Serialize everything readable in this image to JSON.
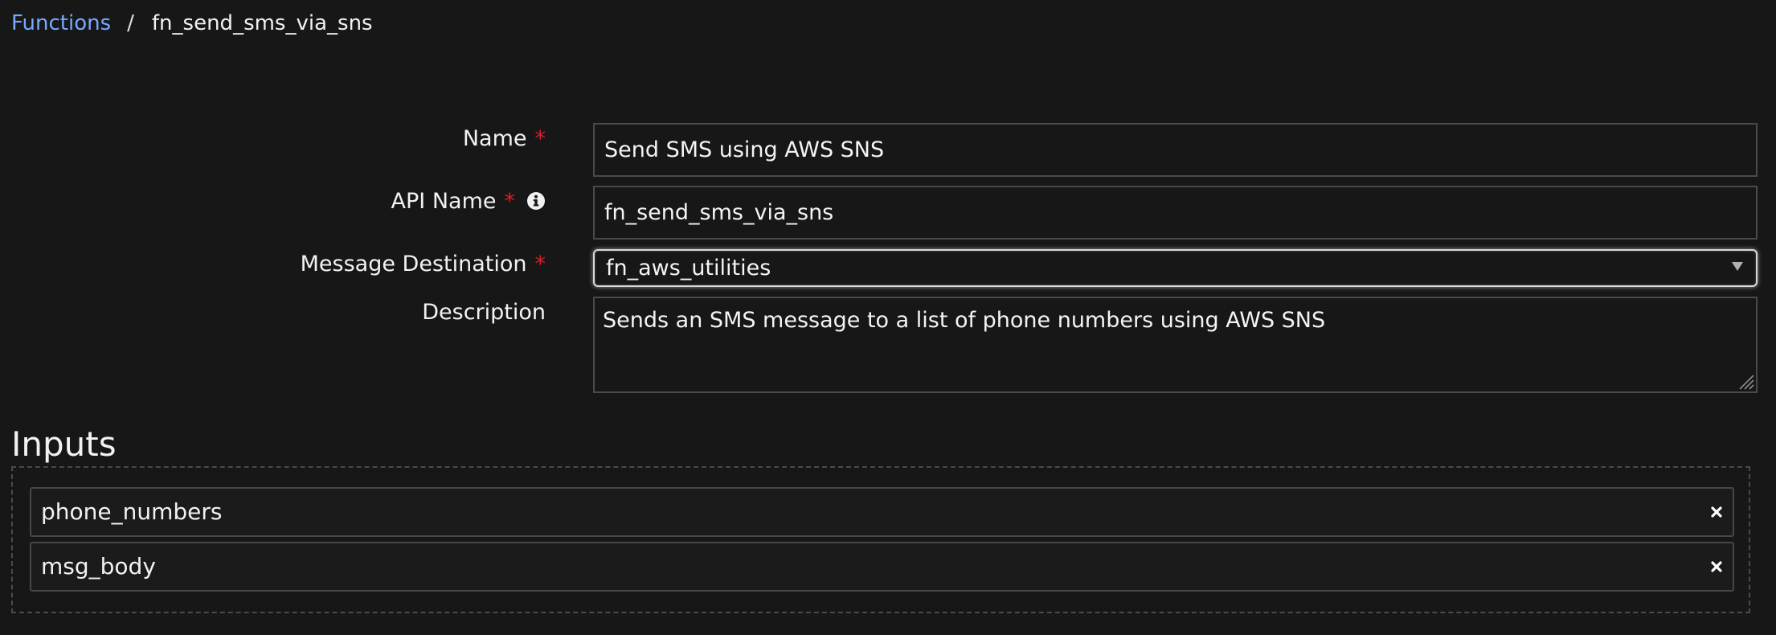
{
  "breadcrumb": {
    "parent": "Functions",
    "separator": "/",
    "current": "fn_send_sms_via_sns"
  },
  "form": {
    "name_label": "Name",
    "name_value": "Send SMS using AWS SNS",
    "api_name_label": "API Name",
    "api_name_value": "fn_send_sms_via_sns",
    "message_destination_label": "Message Destination",
    "message_destination_value": "fn_aws_utilities",
    "description_label": "Description",
    "description_value": "Sends an SMS message to a list of phone numbers using AWS SNS",
    "required_marker": "*"
  },
  "inputs": {
    "title": "Inputs",
    "items": [
      {
        "label": "phone_numbers",
        "remove_icon": "close-icon"
      },
      {
        "label": "msg_body",
        "remove_icon": "close-icon"
      }
    ]
  },
  "icons": {
    "info": "info-icon",
    "select_arrow": "chevron-down-icon",
    "resize": "resize-handle-icon"
  },
  "colors": {
    "background": "#171717",
    "link": "#78a9ff",
    "required": "#da1e28",
    "border": "#4a4a4a",
    "text": "#f2f2f2"
  }
}
